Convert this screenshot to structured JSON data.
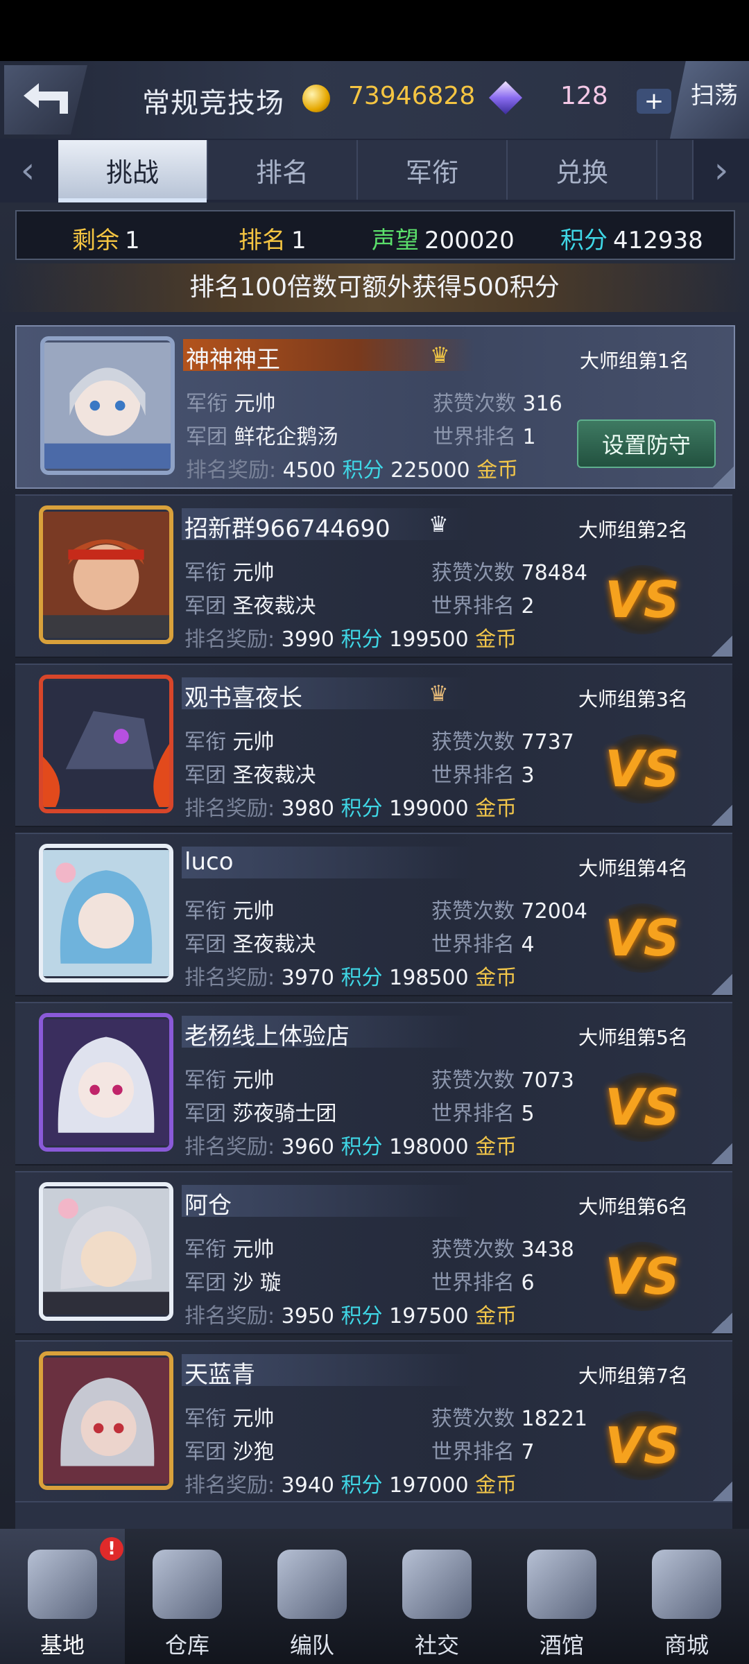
{
  "header": {
    "title": "常规竞技场",
    "gold": "73946828",
    "gems": "128",
    "plus": "+",
    "sweep": "扫荡"
  },
  "tabs": [
    {
      "label": "挑战"
    },
    {
      "label": "排名"
    },
    {
      "label": "军衔"
    },
    {
      "label": "兑换"
    }
  ],
  "stats": {
    "remain_label": "剩余",
    "remain": "1",
    "rank_label": "排名",
    "rank": "1",
    "prestige_label": "声望",
    "prestige": "200020",
    "points_label": "积分",
    "points": "412938"
  },
  "notice": "排名100倍数可额外获得500积分",
  "labels": {
    "rank_title": "军衔",
    "legion": "军团",
    "likes": "获赞次数",
    "world_rank": "世界排名",
    "reward": "排名奖励:",
    "points": "积分",
    "gold": "金币",
    "vs": "VS",
    "defend": "设置防守"
  },
  "players": [
    {
      "name": "神神神王",
      "group": "大师组第1名",
      "title": "元帅",
      "legion": "鲜花企鹅汤",
      "likes": "316",
      "world": "1",
      "reward_pts": "4500",
      "reward_gold": "225000",
      "crown": "♛"
    },
    {
      "name": "招新群966744690",
      "group": "大师组第2名",
      "title": "元帅",
      "legion": "圣夜裁决",
      "likes": "78484",
      "world": "2",
      "reward_pts": "3990",
      "reward_gold": "199500",
      "crown": "♛"
    },
    {
      "name": "观书喜夜长",
      "group": "大师组第3名",
      "title": "元帅",
      "legion": "圣夜裁决",
      "likes": "7737",
      "world": "3",
      "reward_pts": "3980",
      "reward_gold": "199000",
      "crown": "♛"
    },
    {
      "name": "luco",
      "group": "大师组第4名",
      "title": "元帅",
      "legion": "圣夜裁决",
      "likes": "72004",
      "world": "4",
      "reward_pts": "3970",
      "reward_gold": "198500"
    },
    {
      "name": "老杨线上体验店",
      "group": "大师组第5名",
      "title": "元帅",
      "legion": "莎夜骑士团",
      "likes": "7073",
      "world": "5",
      "reward_pts": "3960",
      "reward_gold": "198000"
    },
    {
      "name": "阿仓",
      "group": "大师组第6名",
      "title": "元帅",
      "legion": "沙 璇",
      "likes": "3438",
      "world": "6",
      "reward_pts": "3950",
      "reward_gold": "197500"
    },
    {
      "name": "天蓝青",
      "group": "大师组第7名",
      "title": "元帅",
      "legion": "沙狍",
      "likes": "18221",
      "world": "7",
      "reward_pts": "3940",
      "reward_gold": "197000"
    }
  ],
  "nav": [
    {
      "label": "基地"
    },
    {
      "label": "仓库"
    },
    {
      "label": "编队"
    },
    {
      "label": "社交"
    },
    {
      "label": "酒馆"
    },
    {
      "label": "商城"
    }
  ],
  "badge": "!",
  "colors": {
    "points": "#3fd7e6",
    "gold": "#f2c64a",
    "vs": "#f6a21e",
    "remain": "#f5c542",
    "prestige": "#5be06b"
  }
}
